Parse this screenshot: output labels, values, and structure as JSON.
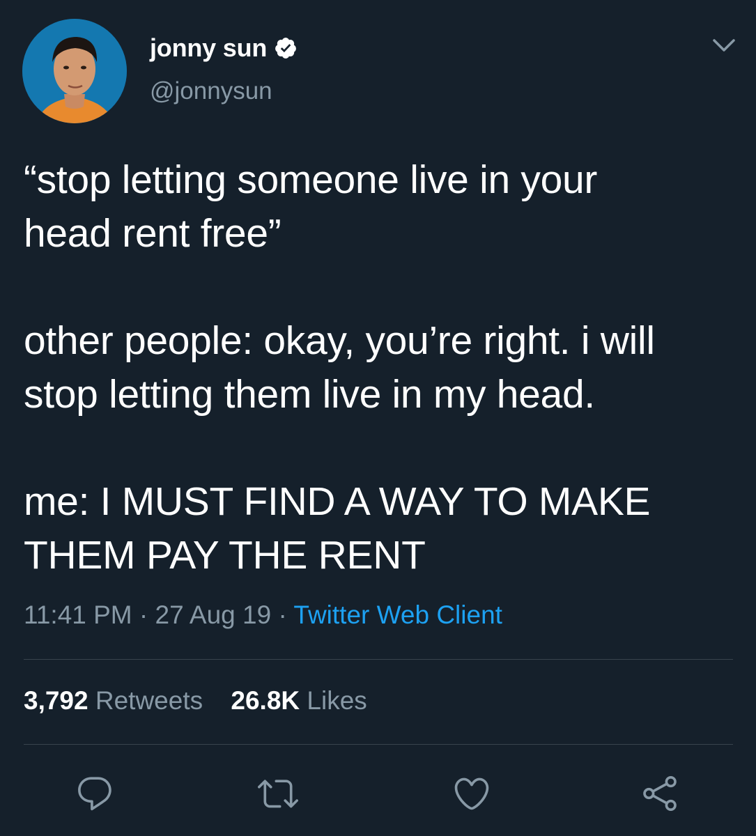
{
  "author": {
    "display_name": "jonny sun",
    "handle": "@jonnysun",
    "verified": true
  },
  "tweet": {
    "paragraphs": [
      "“stop letting someone live in your\nhead rent free”",
      "other people: okay, you’re right. i will\nstop letting them live in my head.",
      "me: I MUST FIND A WAY TO MAKE\nTHEM PAY THE RENT"
    ],
    "time": "11:41 PM",
    "separator": " · ",
    "date": "27 Aug 19",
    "source": "Twitter Web Client"
  },
  "stats": {
    "retweets_count": "3,792",
    "retweets_label": "Retweets",
    "likes_count": "26.8K",
    "likes_label": "Likes"
  },
  "icons": {
    "more": "chevron-down-icon",
    "verified": "verified-badge-icon",
    "reply": "reply-icon",
    "retweet": "retweet-icon",
    "like": "heart-icon",
    "share": "share-icon"
  },
  "colors": {
    "background": "#15202b",
    "text": "#ffffff",
    "secondary": "#8899a6",
    "link": "#1da1f2",
    "divider": "#38444d"
  }
}
